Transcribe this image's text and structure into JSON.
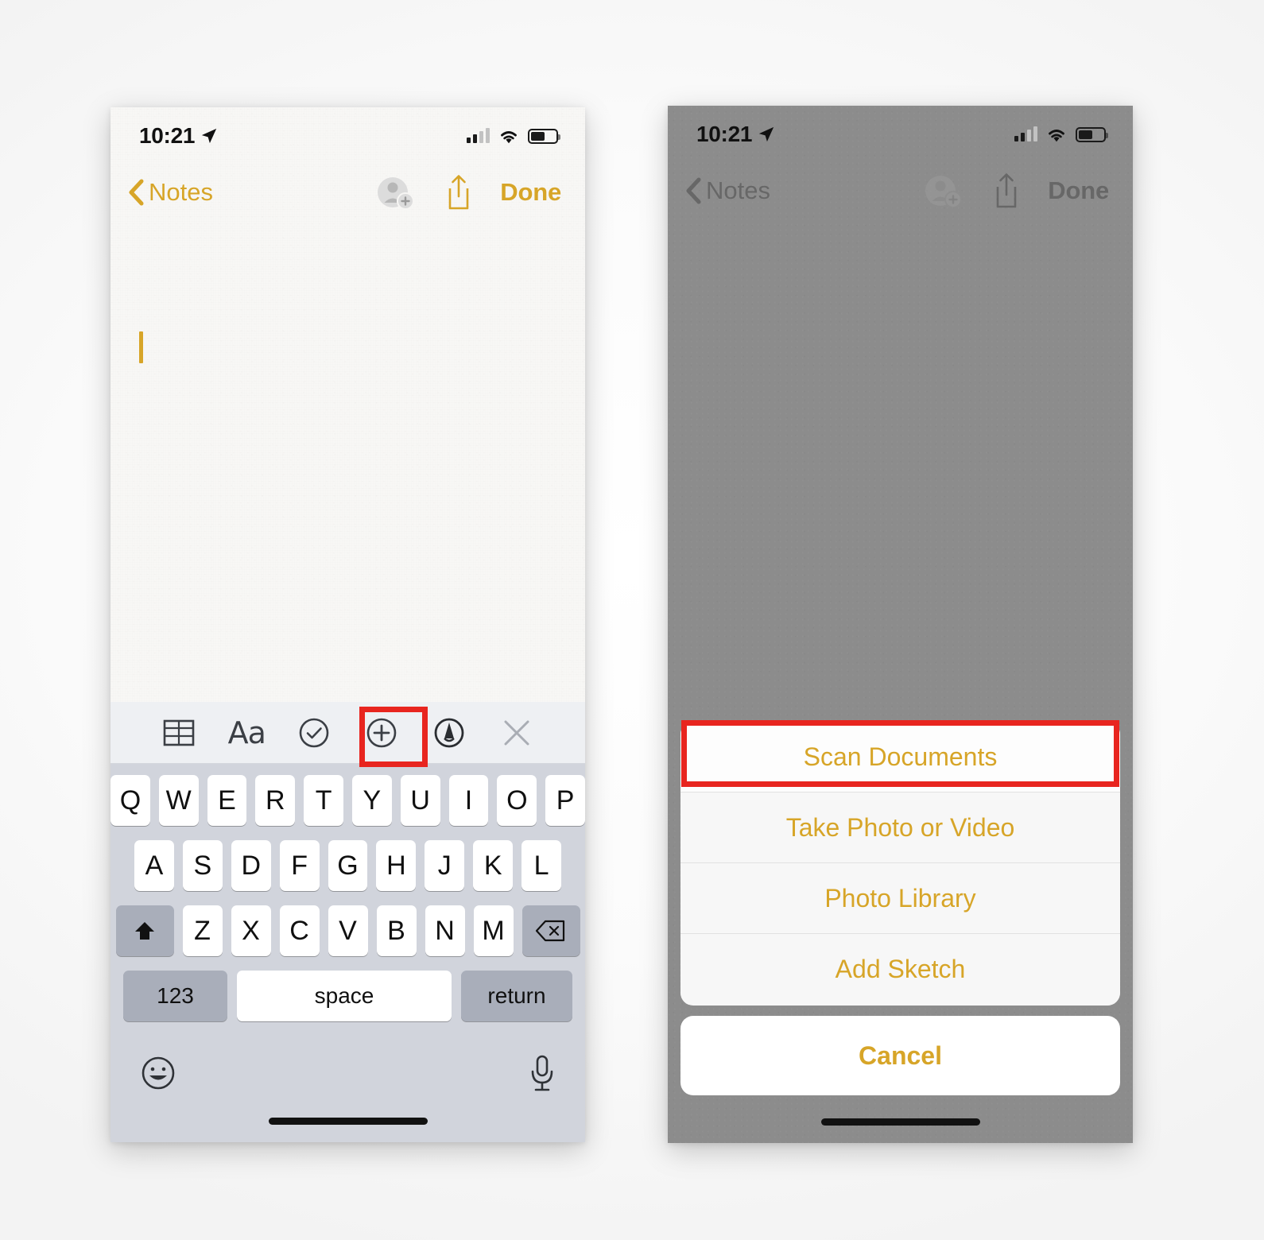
{
  "theme": {
    "accent_gold": "#D7A528",
    "highlight_red": "#E8251F",
    "keyboard_bg": "#D1D4DC",
    "toolbar_bg": "#EEF0F3",
    "dim_overlay": "#8C8C8C"
  },
  "left_phone": {
    "status_bar": {
      "time": "10:21",
      "location_icon": "location-arrow-icon",
      "signal_icon": "cellular-signal-icon",
      "wifi_icon": "wifi-icon",
      "battery_icon": "battery-icon"
    },
    "nav_bar": {
      "back_label": "Notes",
      "back_chevron_icon": "chevron-left-icon",
      "add_person_icon": "add-person-icon",
      "share_icon": "share-icon",
      "done_label": "Done"
    },
    "note": {
      "body_text": "",
      "caret_visible": true
    },
    "accessory_toolbar": {
      "items": [
        {
          "name": "table-icon",
          "label": ""
        },
        {
          "name": "text-format-icon",
          "label": "Aa"
        },
        {
          "name": "checklist-icon",
          "label": ""
        },
        {
          "name": "add-attachment-icon",
          "label": ""
        },
        {
          "name": "markup-pen-icon",
          "label": ""
        },
        {
          "name": "close-keyboard-icon",
          "label": ""
        }
      ],
      "highlighted_item": "add-attachment-icon"
    },
    "keyboard": {
      "row1": [
        "Q",
        "W",
        "E",
        "R",
        "T",
        "Y",
        "U",
        "I",
        "O",
        "P"
      ],
      "row2": [
        "A",
        "S",
        "D",
        "F",
        "G",
        "H",
        "J",
        "K",
        "L"
      ],
      "row3_shift_icon": "shift-icon",
      "row3": [
        "Z",
        "X",
        "C",
        "V",
        "B",
        "N",
        "M"
      ],
      "row3_delete_icon": "delete-backspace-icon",
      "numbers_label": "123",
      "space_label": "space",
      "return_label": "return",
      "emoji_icon": "emoji-smiley-icon",
      "dictation_icon": "microphone-icon"
    }
  },
  "right_phone": {
    "status_bar": {
      "time": "10:21",
      "location_icon": "location-arrow-icon",
      "signal_icon": "cellular-signal-icon",
      "wifi_icon": "wifi-icon",
      "battery_icon": "battery-icon"
    },
    "nav_bar": {
      "back_label": "Notes",
      "back_chevron_icon": "chevron-left-icon",
      "add_person_icon": "add-person-icon",
      "share_icon": "share-icon",
      "done_label": "Done"
    },
    "action_sheet": {
      "options": [
        "Scan Documents",
        "Take Photo or Video",
        "Photo Library",
        "Add Sketch"
      ],
      "cancel_label": "Cancel",
      "highlighted_option": "Scan Documents"
    }
  }
}
